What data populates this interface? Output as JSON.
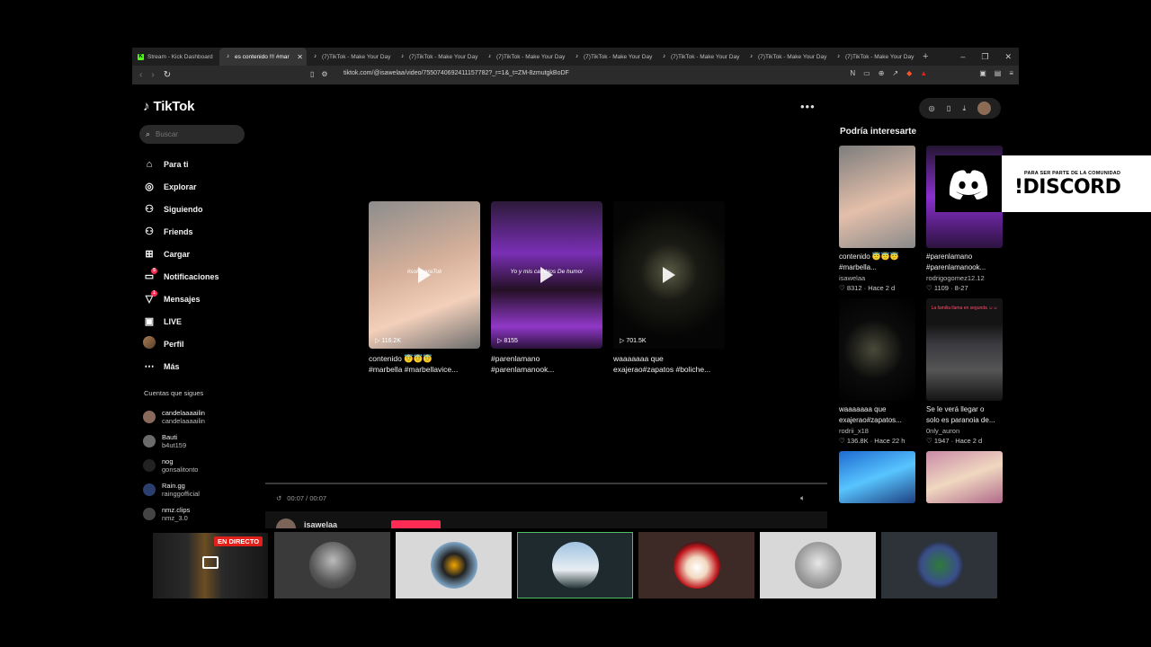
{
  "browser": {
    "tabs": [
      {
        "label": "Stream - Kick Dashboard",
        "favicon": "kick-icon",
        "active": false
      },
      {
        "label": "es contenido !!! #mar",
        "favicon": "tiktok-icon",
        "active": true
      },
      {
        "label": "(7)TikTok - Make Your Day",
        "favicon": "tiktok-icon",
        "active": false
      },
      {
        "label": "(7)TikTok - Make Your Day",
        "favicon": "tiktok-icon",
        "active": false
      },
      {
        "label": "(7)TikTok - Make Your Day",
        "favicon": "tiktok-icon",
        "active": false
      },
      {
        "label": "(7)TikTok - Make Your Day",
        "favicon": "tiktok-icon",
        "active": false
      },
      {
        "label": "(7)TikTok - Make Your Day",
        "favicon": "tiktok-icon",
        "active": false
      },
      {
        "label": "(7)TikTok - Make Your Day",
        "favicon": "tiktok-icon",
        "active": false
      },
      {
        "label": "(7)TikTok - Make Your Day",
        "favicon": "tiktok-icon",
        "active": false
      }
    ],
    "url": "tiktok.com/@isawelaa/video/7550740692411157782?_r=1&_t=ZM-8zmutgkBoDF"
  },
  "tiktok": {
    "logo": "TikTok",
    "search_placeholder": "Buscar",
    "nav": [
      {
        "label": "Para ti",
        "icon": "home-icon",
        "glyph": "⌂"
      },
      {
        "label": "Explorar",
        "icon": "compass-icon",
        "glyph": "◎"
      },
      {
        "label": "Siguiendo",
        "icon": "following-icon",
        "glyph": "⚇"
      },
      {
        "label": "Friends",
        "icon": "friends-icon",
        "glyph": "⚇"
      },
      {
        "label": "Cargar",
        "icon": "upload-icon",
        "glyph": "⊞"
      },
      {
        "label": "Notificaciones",
        "icon": "bell-icon",
        "glyph": "▭",
        "badge": "5"
      },
      {
        "label": "Mensajes",
        "icon": "send-icon",
        "glyph": "▽",
        "badge": "1"
      },
      {
        "label": "LIVE",
        "icon": "live-icon",
        "glyph": "▣"
      },
      {
        "label": "Perfil",
        "icon": "profile-avatar",
        "glyph": ""
      },
      {
        "label": "Más",
        "icon": "more-icon",
        "glyph": "⋯"
      }
    ],
    "following_title": "Cuentas que sigues",
    "following": [
      {
        "name": "candelaaaailin",
        "user": "candelaaaailin"
      },
      {
        "name": "Bauti",
        "user": "b4ut159"
      },
      {
        "name": "nog",
        "user": "gonsalitonto"
      },
      {
        "name": "Rain.gg",
        "user": "rainggofficial"
      },
      {
        "name": "nmz.clips",
        "user": "nmz_3.0"
      }
    ],
    "cards": [
      {
        "views": "116.2K",
        "caption1": "contenido 😇😇😇",
        "caption2": "#marbella #marbellavice...",
        "overlay": "#soloparaTok"
      },
      {
        "views": "8155",
        "caption1": "#parenlamano",
        "caption2": "#parenlamanook...",
        "overlay": "Yo y mis cambios De humor"
      },
      {
        "views": "701.5K",
        "caption1": "waaaaaaa que",
        "caption2": "exajerao#zapatos #boliche...",
        "overlay": ""
      }
    ],
    "player": {
      "time": "00:07 / 00:07",
      "author": "isawelaa"
    },
    "recommended_title": "Podría interesarte",
    "recommended": [
      {
        "caption1": "contenido 😇😇😇",
        "caption2": "#marbella...",
        "user": "isawelaa",
        "likes": "8312",
        "ago": "Hace 2 d"
      },
      {
        "caption1": "#parenlamano",
        "caption2": "#parenlamanook...",
        "user": "rodrigogomez12.12",
        "likes": "1109",
        "ago": "8-27"
      },
      {
        "caption1": "waaaaaaa que",
        "caption2": "exajerao#zapatos...",
        "user": "rodrii_x18",
        "likes": "136.8K",
        "ago": "Hace 22 h"
      },
      {
        "caption1": "Se le verá llegar o",
        "caption2": "solo es paranoia de...",
        "user": "0nly_auron",
        "likes": "1947",
        "ago": "Hace 2 d",
        "overlay": "La familia llama en segunda ☺☺"
      },
      {
        "caption1": "",
        "caption2": "",
        "user": "",
        "likes": "",
        "ago": ""
      },
      {
        "caption1": "",
        "caption2": "",
        "user": "",
        "likes": "",
        "ago": ""
      }
    ]
  },
  "discord_banner": {
    "small_text": "PARA SER PARTE DE LA COMUNIDAD",
    "big_text": "!DISCORD"
  },
  "stream": {
    "live_badge": "EN DIRECTO"
  },
  "colors": {
    "accent": "#fe2c55",
    "kick_green": "#53fc18",
    "live_red": "#e0201b"
  }
}
